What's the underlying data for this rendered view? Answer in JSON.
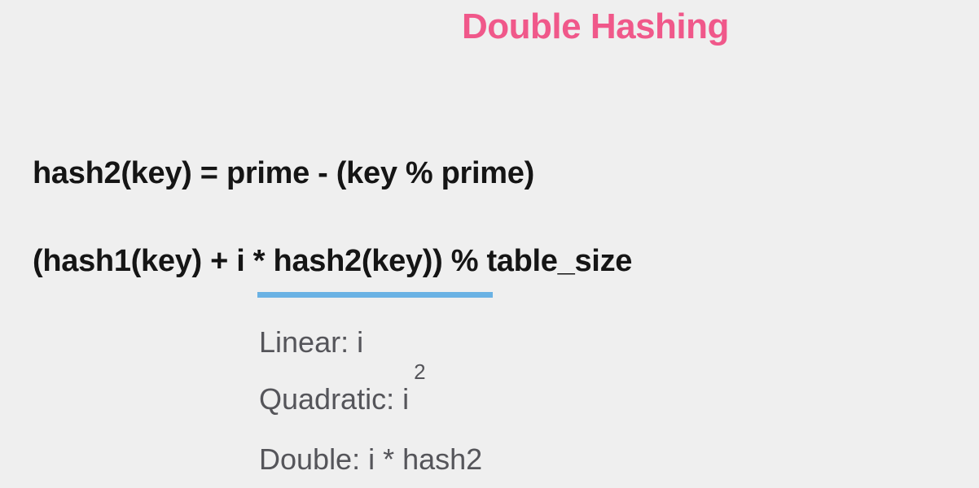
{
  "slide": {
    "title": "Double Hashing",
    "formula_hash2": "hash2(key) = prime - (key % prime)",
    "formula_probe": "(hash1(key) + i * hash2(key)) % table_size",
    "probe_list": {
      "linear": "Linear: i",
      "quadratic_base": "Quadratic: i",
      "quadratic_exponent": "2",
      "double": "Double: i * hash2"
    }
  },
  "colors": {
    "title": "#f0588a",
    "formula_text": "#151515",
    "underline": "#6ab2e4",
    "list_text": "#55555a",
    "background": "#efefef"
  }
}
